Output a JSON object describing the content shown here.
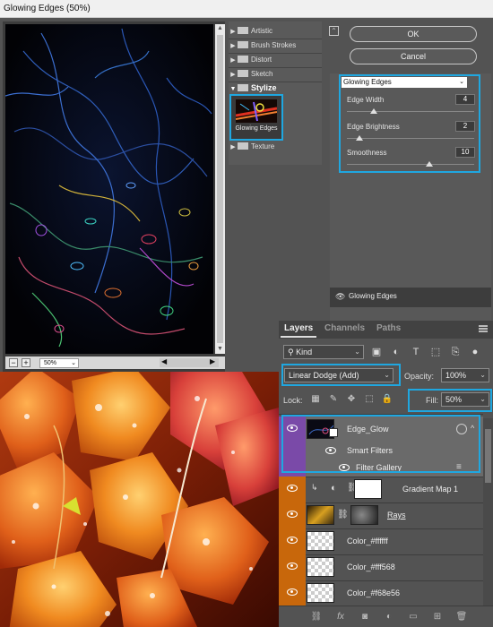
{
  "window": {
    "title": "Glowing Edges (50%)"
  },
  "preview": {
    "zoom": "50%",
    "zoom_in": "+",
    "zoom_out": "−"
  },
  "filter_tree": {
    "categories": [
      {
        "label": "Artistic"
      },
      {
        "label": "Brush Strokes"
      },
      {
        "label": "Distort"
      },
      {
        "label": "Sketch"
      },
      {
        "label": "Stylize"
      },
      {
        "label": "Texture"
      }
    ],
    "selected_thumb_label": "Glowing Edges"
  },
  "buttons": {
    "ok": "OK",
    "cancel": "Cancel"
  },
  "settings": {
    "filter": "Glowing Edges",
    "params": [
      {
        "label": "Edge Width",
        "value": "4",
        "fraction": 0.21
      },
      {
        "label": "Edge Brightness",
        "value": "2",
        "fraction": 0.1
      },
      {
        "label": "Smoothness",
        "value": "10",
        "fraction": 0.65
      }
    ]
  },
  "applied_filters": [
    {
      "label": "Glowing Edges"
    }
  ],
  "layers_panel": {
    "tabs": [
      {
        "label": "Layers"
      },
      {
        "label": "Channels"
      },
      {
        "label": "Paths"
      }
    ],
    "kind": "Kind",
    "blend_mode": "Linear Dodge (Add)",
    "opacity_label": "Opacity:",
    "opacity": "100%",
    "lock_label": "Lock:",
    "fill_label": "Fill:",
    "fill": "50%",
    "layers": [
      {
        "name": "Edge_Glow",
        "color": "#7a4aa8"
      },
      {
        "name": "Smart Filters"
      },
      {
        "name": "Filter Gallery"
      },
      {
        "name": "Gradient Map 1"
      },
      {
        "name": "Rays"
      },
      {
        "name": "Color_#ffffff"
      },
      {
        "name": "Color_#fff568"
      },
      {
        "name": "Color_#f68e56"
      }
    ],
    "eye_color": "#c8670b",
    "footer_icons": [
      "link-icon",
      "fx-icon",
      "mask-icon",
      "adjustment-icon",
      "group-icon",
      "new-layer-icon",
      "trash-icon"
    ]
  }
}
